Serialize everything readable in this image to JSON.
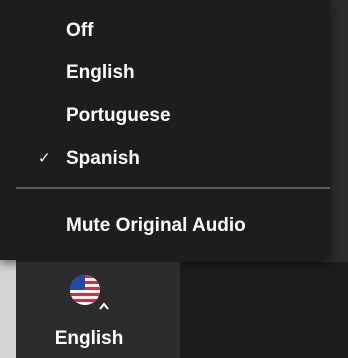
{
  "menu": {
    "items": [
      {
        "label": "Off",
        "checked": false
      },
      {
        "label": "English",
        "checked": false
      },
      {
        "label": "Portuguese",
        "checked": false
      },
      {
        "label": "Spanish",
        "checked": true
      }
    ],
    "check_glyph": "✓",
    "mute_label": "Mute Original Audio"
  },
  "toolbar": {
    "language_button": {
      "label": "English",
      "icon": "us-flag-icon",
      "caret_icon": "chevron-up-icon"
    }
  },
  "colors": {
    "menu_background": "#1d1d1d",
    "toolbar_background": "#2c2c2c",
    "text": "#ffffff",
    "separator": "#5a5a5a"
  }
}
